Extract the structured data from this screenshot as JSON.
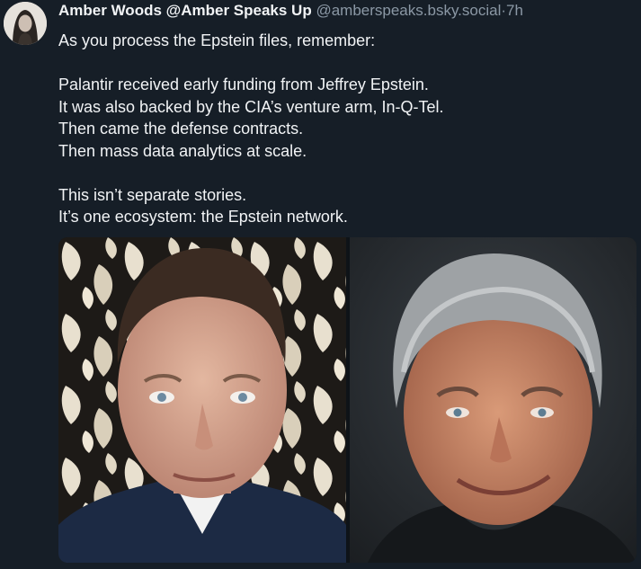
{
  "post": {
    "display_name": "Amber Woods @Amber Speaks Up",
    "handle": "@amberspeaks.bsky.social",
    "separator": "·",
    "timestamp": "7h",
    "text_lines": [
      "As you process the Epstein files, remember:",
      "",
      "Palantir received early funding from Jeffrey Epstein.",
      "It was also backed by the CIA’s venture arm, In-Q-Tel.",
      "Then came the defense contracts.",
      "Then mass data analytics at scale.",
      "",
      "This isn’t separate stories.",
      "It’s one ecosystem: the Epstein network."
    ]
  },
  "colors": {
    "background": "#161e27",
    "text": "#f1f3f5",
    "muted": "#8b98a5"
  },
  "media": {
    "photos": [
      {
        "name": "photo-left",
        "icon": "portrait-man-suit-patterned-background"
      },
      {
        "name": "photo-right",
        "icon": "portrait-man-gray-hair-dark-background"
      }
    ]
  }
}
